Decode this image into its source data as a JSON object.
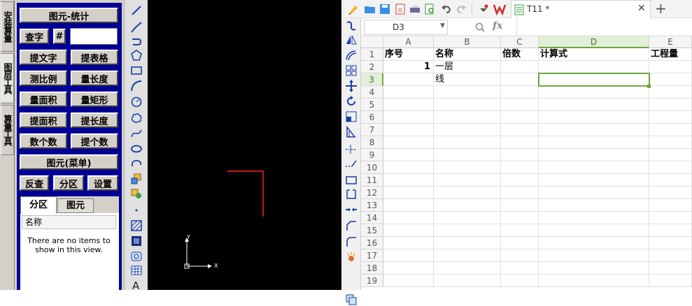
{
  "side_tabs": [
    "安装算量",
    "图层工具",
    "算量工具"
  ],
  "panel": {
    "title_button": "图元-统计",
    "find_label": "查字",
    "hash_label": "#",
    "find_input_value": "",
    "buttons_row1": [
      "提文字",
      "提表格"
    ],
    "buttons_row2": [
      "测比例",
      "量长度"
    ],
    "buttons_row3": [
      "量面积",
      "量矩形"
    ],
    "buttons_row4": [
      "提面积",
      "提长度"
    ],
    "buttons_row5": [
      "数个数",
      "提个数"
    ],
    "menu_button": "图元(菜单)",
    "bottom_buttons": [
      "反查",
      "分区",
      "设置"
    ],
    "tabs": [
      "分区",
      "图元"
    ],
    "list_header": "名称",
    "empty_text": "There are no items to show in this view."
  },
  "canvas": {
    "axis_x": "X",
    "axis_y": "Y"
  },
  "sheet": {
    "tab_title": "T11 *",
    "cell_ref": "D3",
    "fx_label": "fx",
    "formula_value": "",
    "columns": [
      "A",
      "B",
      "C",
      "D",
      "E"
    ],
    "rows": [
      "1",
      "2",
      "3",
      "4",
      "5",
      "6",
      "7",
      "8",
      "9",
      "10",
      "11",
      "12",
      "13",
      "14",
      "15",
      "16",
      "17",
      "18",
      "19"
    ],
    "headers": [
      "序号",
      "名称",
      "倍数",
      "计算式",
      "工程量"
    ],
    "row2": {
      "a": "1",
      "b": "一层"
    },
    "row3": {
      "b": "线"
    },
    "accent_color": "#6ea441"
  }
}
